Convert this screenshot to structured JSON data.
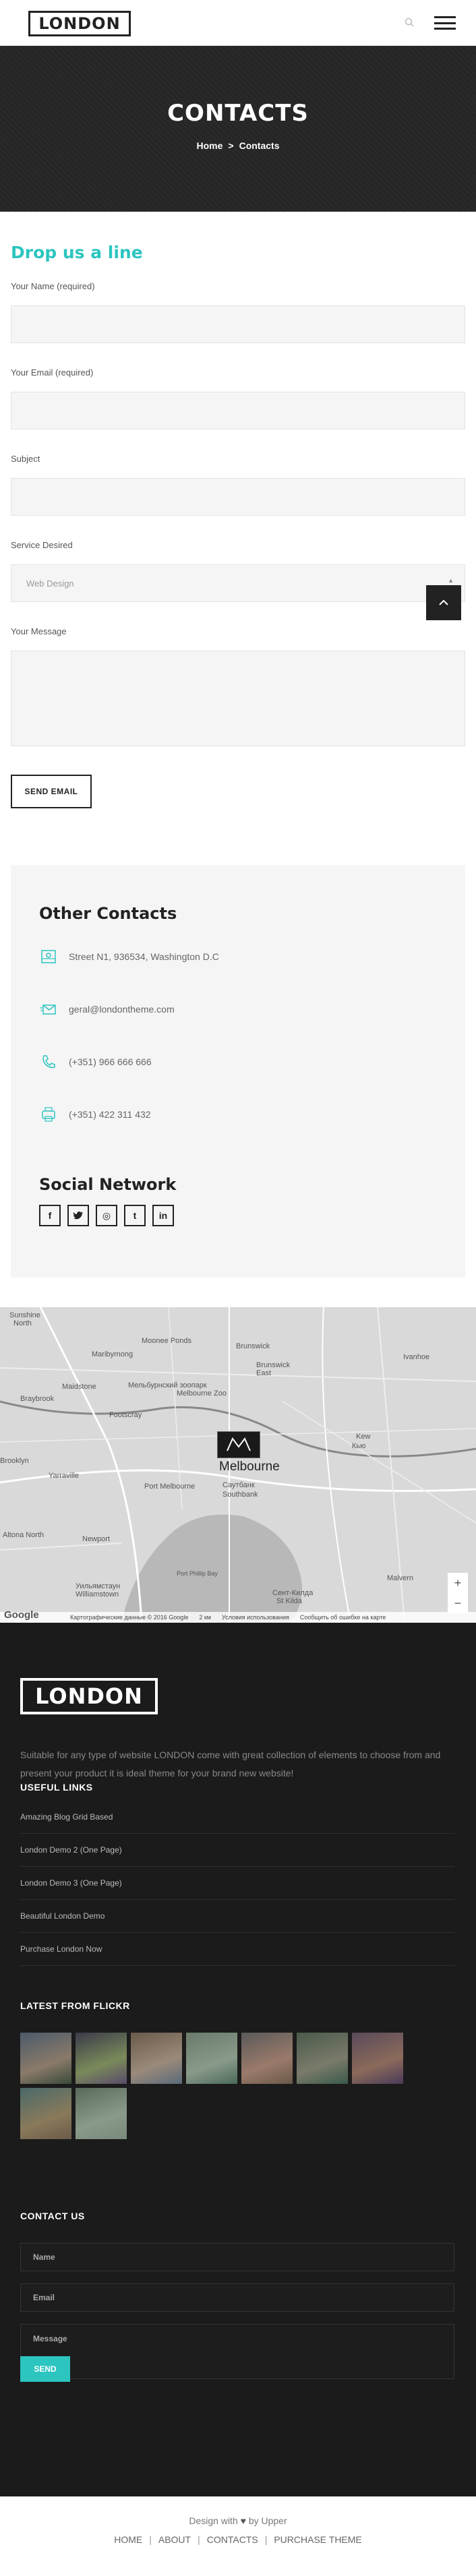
{
  "header": {
    "logo": "LONDON"
  },
  "hero": {
    "title": "CONTACTS",
    "breadcrumb": {
      "home": "Home",
      "sep": ">",
      "current": "Contacts"
    }
  },
  "form": {
    "title": "Drop us a line",
    "name_label": "Your Name (required)",
    "email_label": "Your Email (required)",
    "subject_label": "Subject",
    "service_label": "Service Desired",
    "service_value": "Web Design",
    "message_label": "Your Message",
    "submit": "SEND EMAIL"
  },
  "other_contacts": {
    "title": "Other Contacts",
    "address": "Street N1, 936534, Washington D.C",
    "email": "geral@londontheme.com",
    "phone": "(+351) 966 666 666",
    "fax": "(+351) 422 311 432"
  },
  "social": {
    "title": "Social Network",
    "items": [
      {
        "name": "facebook",
        "glyph": "f"
      },
      {
        "name": "twitter",
        "glyph": "t"
      },
      {
        "name": "dribbble",
        "glyph": "◎"
      },
      {
        "name": "tumblr",
        "glyph": "t"
      },
      {
        "name": "linkedin",
        "glyph": "in"
      }
    ]
  },
  "map": {
    "city": "Melbourne",
    "labels": [
      {
        "text": "Sunshine"
      },
      {
        "text": "North"
      },
      {
        "text": "Moonee Ponds"
      },
      {
        "text": "Brunswick"
      },
      {
        "text": "Maribyrnong"
      },
      {
        "text": "Brunswick East"
      },
      {
        "text": "Ivanhoe"
      },
      {
        "text": "Maidstone"
      },
      {
        "text": "Мельбурнский зоопарк"
      },
      {
        "text": "Melbourne Zoo"
      },
      {
        "text": "Braybrook"
      },
      {
        "text": "Footscray"
      },
      {
        "text": "Kew"
      },
      {
        "text": "Кью"
      },
      {
        "text": "Brooklyn"
      },
      {
        "text": "Yarraville"
      },
      {
        "text": "Port Melbourne"
      },
      {
        "text": "Саутбанк"
      },
      {
        "text": "Southbank"
      },
      {
        "text": "Altona North"
      },
      {
        "text": "Newport"
      },
      {
        "text": "Уильямстаун"
      },
      {
        "text": "Williamstown"
      },
      {
        "text": "Port Phillip Bay"
      },
      {
        "text": "Сент-Килда"
      },
      {
        "text": "St Kilda"
      },
      {
        "text": "Malvern"
      }
    ],
    "footer": [
      "Картографические данные © 2016 Google",
      "2 км",
      "Условия использования",
      "Сообщить об ошибке на карте"
    ],
    "google": "Google",
    "zoom_in": "+",
    "zoom_out": "−"
  },
  "footer": {
    "logo": "LONDON",
    "description": "Suitable for any type of website LONDON come with great collection of elements to choose from and present your product it is ideal theme for your brand new website!",
    "useful_title": "USEFUL LINKS",
    "links": [
      "Amazing Blog Grid Based",
      "London Demo 2 (One Page)",
      "London Demo 3 (One Page)",
      "Beautiful London Demo",
      "Purchase London Now"
    ],
    "flickr_title": "LATEST FROM FLICKR",
    "contact_title": "CONTACT US",
    "name_ph": "Name",
    "email_ph": "Email",
    "message_ph": "Message",
    "send": "SEND"
  },
  "bottom": {
    "credit_pre": "Design with",
    "credit_post": "by Upper",
    "nav": [
      "HOME",
      "ABOUT",
      "CONTACTS",
      "PURCHASE THEME"
    ]
  },
  "colors": {
    "accent": "#2cc5c0",
    "dark": "#1b1b1b",
    "hero": "#262626"
  }
}
